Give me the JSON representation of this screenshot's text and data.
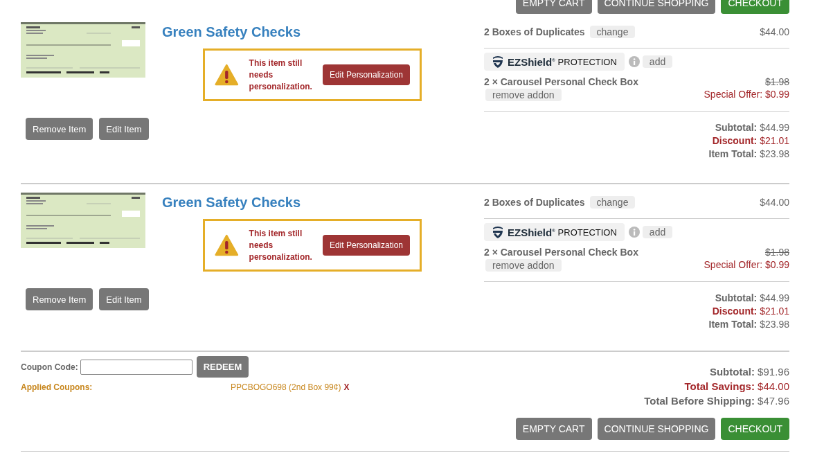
{
  "top_actions": [
    {
      "label": "EMPTY CART",
      "kind": "secondary"
    },
    {
      "label": "CONTINUE SHOPPING",
      "kind": "secondary"
    },
    {
      "label": "CHECKOUT",
      "kind": "primary"
    }
  ],
  "items": [
    {
      "title": "Green Safety Checks",
      "warning": "This item still needs personalization.",
      "warning_action": "Edit Personalization",
      "buttons": [
        "Remove Item",
        "Edit Item"
      ],
      "option": {
        "label": "2 Boxes of Duplicates",
        "action": "change",
        "price": "$44.00"
      },
      "protection": {
        "brand": "EZShield$^{®}$",
        "label": "PROTECTION",
        "action": "add"
      },
      "addon": {
        "quantity": "2 ×",
        "name": "Carousel Personal Check Box",
        "action": "remove addon",
        "original_price": "$1.98",
        "offer_label": "Special Offer:",
        "offer_price": "$0.99"
      },
      "totals": [
        {
          "label": "Subtotal:",
          "value": "$44.99",
          "kind": "normal"
        },
        {
          "label": "Discount:",
          "value": "$21.01",
          "kind": "discount"
        },
        {
          "label": "Item Total:",
          "value": "$23.98",
          "kind": "normal"
        }
      ]
    },
    {
      "title": "Green Safety Checks",
      "warning": "This item still needs personalization.",
      "warning_action": "Edit Personalization",
      "buttons": [
        "Remove Item",
        "Edit Item"
      ],
      "option": {
        "label": "2 Boxes of Duplicates",
        "action": "change",
        "price": "$44.00"
      },
      "protection": {
        "brand": "EZShield$^{®}$",
        "label": "PROTECTION",
        "action": "add"
      },
      "addon": {
        "quantity": "2 ×",
        "name": "Carousel Personal Check Box",
        "action": "remove addon",
        "original_price": "$1.98",
        "offer_label": "Special Offer:",
        "offer_price": "$0.99"
      },
      "totals": [
        {
          "label": "Subtotal:",
          "value": "$44.99",
          "kind": "normal"
        },
        {
          "label": "Discount:",
          "value": "$21.01",
          "kind": "discount"
        },
        {
          "label": "Item Total:",
          "value": "$23.98",
          "kind": "normal"
        }
      ]
    }
  ],
  "coupon": {
    "label": "Coupon Code:",
    "button": "REDEEM",
    "applied_label": "Applied Coupons:",
    "applied": [
      {
        "code": "PPCBOGO698 (2nd Box 99¢)",
        "remove": "X"
      }
    ]
  },
  "order_totals": [
    {
      "label": "Subtotal:",
      "value": "$91.96",
      "kind": "normal"
    },
    {
      "label": "Total Savings:",
      "value": "$44.00",
      "kind": "savings"
    },
    {
      "label": "Total Before Shipping:",
      "value": "$47.96",
      "kind": "normal"
    }
  ],
  "bottom_actions": [
    {
      "label": "EMPTY CART",
      "kind": "secondary"
    },
    {
      "label": "CONTINUE SHOPPING",
      "kind": "secondary"
    },
    {
      "label": "CHECKOUT",
      "kind": "primary"
    }
  ]
}
